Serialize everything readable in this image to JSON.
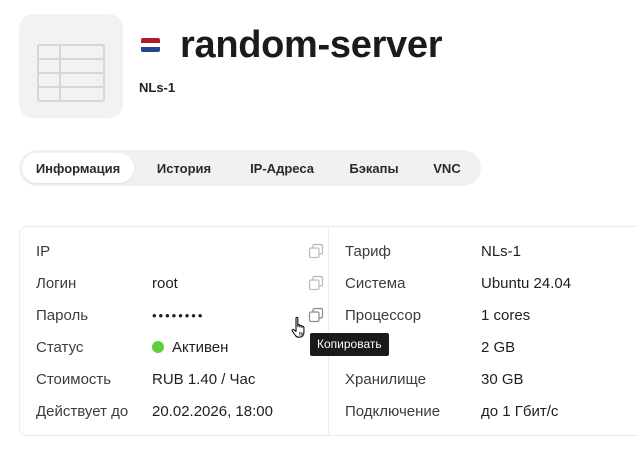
{
  "server": {
    "name": "random-server",
    "plan_code": "NLs-1",
    "flag_colors": [
      "#AE1C28",
      "#FFFFFF",
      "#21468B"
    ]
  },
  "tabs": [
    {
      "label": "Информация",
      "active": true
    },
    {
      "label": "История",
      "active": false
    },
    {
      "label": "IP-Адреса",
      "active": false
    },
    {
      "label": "Бэкапы",
      "active": false
    },
    {
      "label": "VNC",
      "active": false
    }
  ],
  "info_left": {
    "ip_label": "IP",
    "ip_value": "",
    "login_label": "Логин",
    "login_value": "root",
    "password_label": "Пароль",
    "password_value": "••••••••",
    "status_label": "Статус",
    "status_value": "Активен",
    "status_color": "#5fcf3c",
    "cost_label": "Стоимость",
    "cost_value": "RUB 1.40 / Час",
    "valid_label": "Действует до",
    "valid_value": "20.02.2026, 18:00"
  },
  "info_right": {
    "tariff_label": "Тариф",
    "tariff_value": "NLs-1",
    "system_label": "Система",
    "system_value": "Ubuntu 24.04",
    "cpu_label": "Процессор",
    "cpu_value": "1 cores",
    "ram_label": "",
    "ram_value": "2 GB",
    "storage_label": "Хранилище",
    "storage_value": "30 GB",
    "connection_label": "Подключение",
    "connection_value": "до 1 Гбит/с"
  },
  "tooltip": {
    "text": "Копировать"
  },
  "icons": {
    "copy": "copy-icon",
    "server_thumb": "table-icon",
    "cursor": "hand-pointer-icon"
  }
}
